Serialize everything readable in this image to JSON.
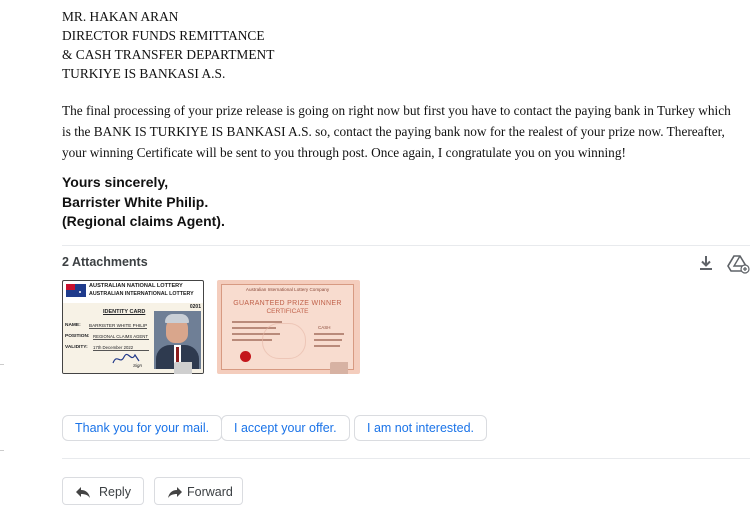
{
  "sender_block": {
    "line1": "MR. HAKAN ARAN",
    "line2": "DIRECTOR FUNDS REMITTANCE",
    "line3": "& CASH TRANSFER DEPARTMENT",
    "line4": "TURKIYE IS BANKASI A.S."
  },
  "body": {
    "paragraph": "The final processing of your prize release is going on right now but first you have to contact the paying bank in Turkey which is the BANK IS TURKIYE IS BANKASI A.S. so, contact the paying bank now for the realest of your prize now. Thereafter, your winning Certificate will be sent to you through post. Once again, I congratulate you on you winning!"
  },
  "signature": {
    "line1": "Yours sincerely,",
    "line2": "Barrister White Philip.",
    "line3": "(Regional claims Agent)."
  },
  "attachments": {
    "title": "2 Attachments",
    "download_icon": "download-icon",
    "drive_icon": "add-to-drive-icon",
    "card1": {
      "header1": "AUSTRALIAN NATIONAL LOTTERY",
      "header2": "AUSTRALIAN INTERNATIONAL LOTTERY",
      "number": "0201",
      "id_title": "IDENTITY CARD",
      "name_label": "NAME:",
      "name_value": "BARRISTER WHITE PHILIP",
      "position_label": "POSITION:",
      "position_value": "REGIONAL CLAIMS AGENT",
      "validity_label": "VALIDITY:",
      "validity_value": "17th December 2022",
      "sign_label": "Sign"
    },
    "card2": {
      "header": "Australian International Lottery Company",
      "title1": "GUARANTEED PRIZE WINNER",
      "title2": "CERTIFICATE",
      "cash_label": "CASH"
    }
  },
  "smart_replies": {
    "reply1": "Thank you for your mail.",
    "reply2": "I accept your offer.",
    "reply3": "I am not interested."
  },
  "actions": {
    "reply": "Reply",
    "forward": "Forward",
    "reply_icon": "reply-arrow-icon",
    "forward_icon": "forward-arrow-icon"
  },
  "colors": {
    "link_blue": "#1a73e8",
    "text_dark": "#202124",
    "icon_gray": "#5f6368",
    "border": "#dadce0",
    "certificate_bg": "#f4cdbd"
  }
}
